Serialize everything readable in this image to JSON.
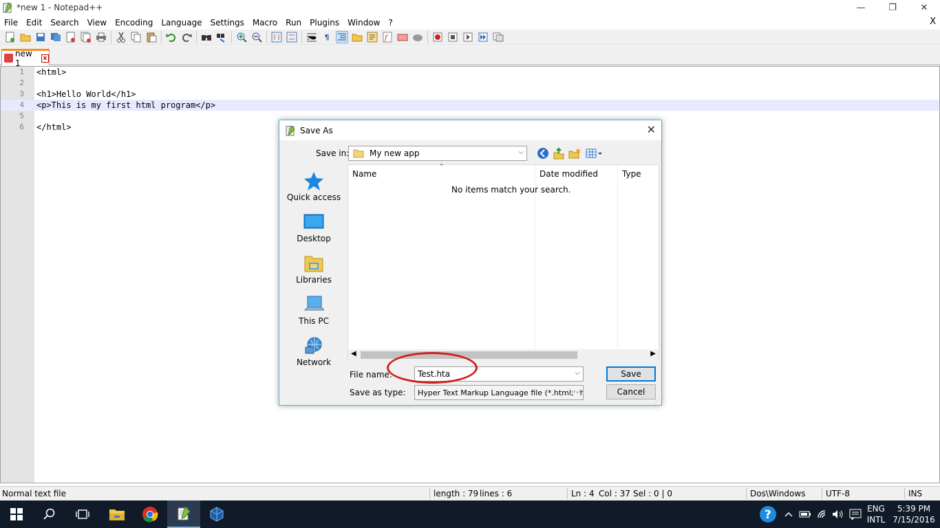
{
  "window": {
    "title": "*new 1 - Notepad++",
    "minimize": "—",
    "restore": "❐",
    "close": "✕"
  },
  "menu": {
    "items": [
      "File",
      "Edit",
      "Search",
      "View",
      "Encoding",
      "Language",
      "Settings",
      "Macro",
      "Run",
      "Plugins",
      "Window",
      "?"
    ],
    "close_doc": "X"
  },
  "tab": {
    "label": "new 1",
    "close": "x"
  },
  "editor": {
    "lines": [
      {
        "num": "1",
        "code": "<html>"
      },
      {
        "num": "2",
        "code": ""
      },
      {
        "num": "3",
        "code": "<h1>Hello World</h1>"
      },
      {
        "num": "4",
        "code": "<p>This is my first html program</p>"
      },
      {
        "num": "5",
        "code": ""
      },
      {
        "num": "6",
        "code": "</html>"
      }
    ],
    "current_line": 4
  },
  "statusbar": {
    "file_type": "Normal text file",
    "length": "length : 79",
    "lines": "lines : 6",
    "ln": "Ln : 4",
    "col": "Col : 37",
    "sel": "Sel : 0 | 0",
    "eol": "Dos\\Windows",
    "encoding": "UTF-8",
    "mode": "INS"
  },
  "dialog": {
    "title": "Save As",
    "close": "✕",
    "save_in_label": "Save in:",
    "save_in_value": "My new app",
    "places": [
      "Quick access",
      "Desktop",
      "Libraries",
      "This PC",
      "Network"
    ],
    "columns": [
      "Name",
      "Date modified",
      "Type"
    ],
    "empty_message": "No items match your search.",
    "file_name_label": "File name:",
    "file_name_value": "Test.hta",
    "save_type_label": "Save as type:",
    "save_type_value": "Hyper Text Markup Language file (*.html;*.htm;*",
    "save_button": "Save",
    "cancel_button": "Cancel"
  },
  "taskbar": {
    "lang_1": "ENG",
    "lang_2": "INTL",
    "time": "5:39 PM",
    "date": "7/15/2016"
  },
  "colors": {
    "tab_accent": "#fa8c1e",
    "annotation": "#d21e1e",
    "dialog_border": "#4cb8c4",
    "default_button": "#0078d7",
    "taskbar": "#101a28"
  }
}
